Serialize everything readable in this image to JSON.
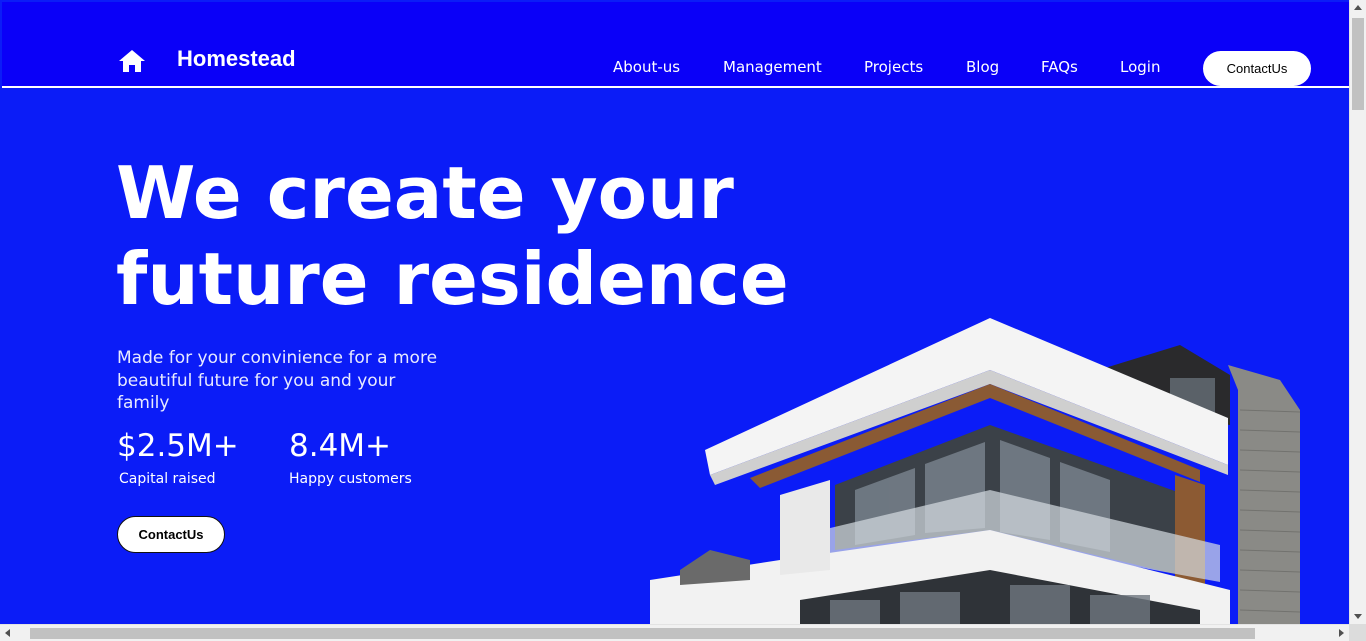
{
  "brand": {
    "name": "Homestead",
    "icon": "home-icon"
  },
  "nav": {
    "items": [
      {
        "label": "About-us"
      },
      {
        "label": "Management"
      },
      {
        "label": "Projects"
      },
      {
        "label": "Blog"
      },
      {
        "label": "FAQs"
      },
      {
        "label": "Login"
      }
    ],
    "contact_label": "ContactUs"
  },
  "hero": {
    "title_line1": "We create your",
    "title_line2": "future residence",
    "subtitle": "Made for your convinience for a more beautiful future for you and your family",
    "stats": [
      {
        "value": "$2.5M+",
        "label": "Capital raised"
      },
      {
        "value": "8.4M+",
        "label": "Happy customers"
      }
    ],
    "contact_label": "ContactUs",
    "image": "modern-house-image"
  },
  "colors": {
    "header_bg": "#0a00f8",
    "hero_bg": "#0b1cf7",
    "text": "#ffffff",
    "button_bg": "#ffffff"
  }
}
